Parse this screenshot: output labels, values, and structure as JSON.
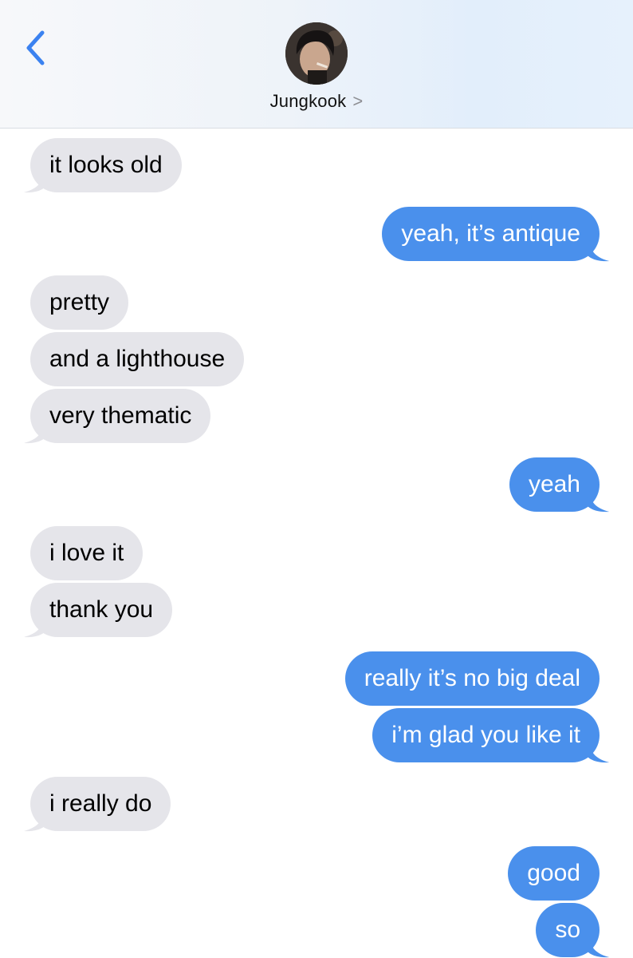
{
  "header": {
    "contact_name": "Jungkook",
    "chevron": ">",
    "icons": {
      "back": "chevron-left-icon",
      "avatar": "avatar"
    },
    "accent_color": "#3b82f0"
  },
  "colors": {
    "incoming_bubble": "#e5e5ea",
    "outgoing_bubble": "#4a90ec"
  },
  "messages": [
    {
      "direction": "incoming",
      "text": "it looks old"
    },
    {
      "direction": "outgoing",
      "text": "yeah, it’s antique"
    },
    {
      "direction": "incoming",
      "text": "pretty"
    },
    {
      "direction": "incoming",
      "text": "and a lighthouse"
    },
    {
      "direction": "incoming",
      "text": "very thematic"
    },
    {
      "direction": "outgoing",
      "text": "yeah"
    },
    {
      "direction": "incoming",
      "text": "i love it"
    },
    {
      "direction": "incoming",
      "text": "thank you"
    },
    {
      "direction": "outgoing",
      "text": "really it’s no big deal"
    },
    {
      "direction": "outgoing",
      "text": "i’m glad you like it"
    },
    {
      "direction": "incoming",
      "text": "i really do"
    },
    {
      "direction": "outgoing",
      "text": "good"
    },
    {
      "direction": "outgoing",
      "text": "so"
    }
  ]
}
